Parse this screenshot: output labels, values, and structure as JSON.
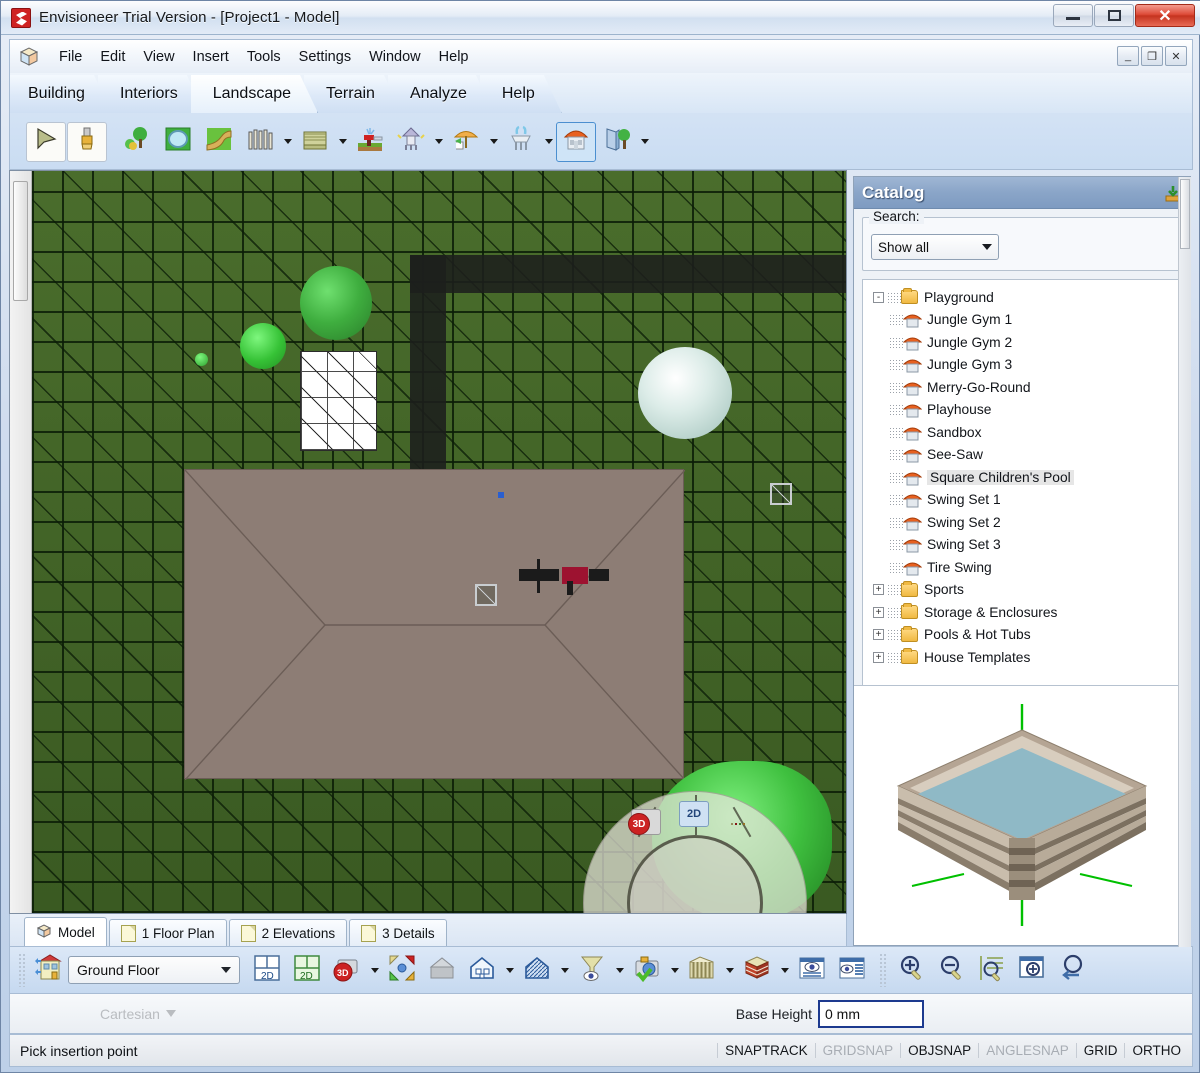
{
  "window": {
    "title": "Envisioneer Trial Version - [Project1 - Model]",
    "app_icon": "envisioneer-logo-icon",
    "minimize": "–",
    "maximize": "❐",
    "close": "✕"
  },
  "mdi_buttons": {
    "minimize": "_",
    "restore": "❐",
    "close": "✕"
  },
  "menu": {
    "items": [
      "File",
      "Edit",
      "View",
      "Insert",
      "Tools",
      "Settings",
      "Window",
      "Help"
    ]
  },
  "ribbon": {
    "tabs": [
      {
        "label": "Building",
        "active": false
      },
      {
        "label": "Interiors",
        "active": false
      },
      {
        "label": "Landscape",
        "active": true
      },
      {
        "label": "Terrain",
        "active": false
      },
      {
        "label": "Analyze",
        "active": false
      },
      {
        "label": "Help",
        "active": false
      }
    ],
    "tools": [
      {
        "name": "select-arrow-tool",
        "icon": "arrow-cursor-icon",
        "framed": true,
        "dropdown": false
      },
      {
        "name": "paintbrush-tool",
        "icon": "paintbrush-icon",
        "framed": true,
        "dropdown": false
      },
      {
        "name": "plants-tool",
        "icon": "tree-shrub-icon",
        "framed": false,
        "dropdown": false
      },
      {
        "name": "pond-tool",
        "icon": "pond-water-icon",
        "framed": false,
        "dropdown": false
      },
      {
        "name": "path-tool",
        "icon": "curved-path-icon",
        "framed": false,
        "dropdown": false
      },
      {
        "name": "fence-tool",
        "icon": "fence-icon",
        "framed": false,
        "dropdown": true
      },
      {
        "name": "deck-tool",
        "icon": "deck-bench-icon",
        "framed": false,
        "dropdown": true
      },
      {
        "name": "sprinkler-tool",
        "icon": "sprinkler-icon",
        "framed": false,
        "dropdown": false
      },
      {
        "name": "lamp-post-tool",
        "icon": "garden-lamp-icon",
        "framed": false,
        "dropdown": true
      },
      {
        "name": "umbrella-tool",
        "icon": "patio-umbrella-icon",
        "framed": false,
        "dropdown": true
      },
      {
        "name": "fountain-tool",
        "icon": "fountain-icon",
        "framed": false,
        "dropdown": true
      },
      {
        "name": "playground-tool",
        "icon": "gazebo-playhouse-icon",
        "framed": false,
        "dropdown": false,
        "selected": true
      },
      {
        "name": "catalog-browser-tool",
        "icon": "book-tree-icon",
        "framed": false,
        "dropdown": true
      }
    ]
  },
  "canvas": {
    "objects": [
      {
        "name": "house-roof-plan",
        "type": "roof"
      },
      {
        "name": "window-frame-object",
        "type": "window"
      },
      {
        "name": "tree-large",
        "type": "tree"
      },
      {
        "name": "tree-medium",
        "type": "tree"
      },
      {
        "name": "tree-small",
        "type": "tree"
      },
      {
        "name": "flowering-tree-white",
        "type": "tree"
      },
      {
        "name": "hedge-bush",
        "type": "hedge"
      },
      {
        "name": "signpost-object",
        "type": "signpost"
      }
    ],
    "radial_menu": {
      "items": [
        {
          "name": "view-3d-button",
          "label": "3D"
        },
        {
          "name": "view-2d-button",
          "label": "2D"
        },
        {
          "name": "move-handles-button",
          "label": ""
        },
        {
          "name": "rotate-button",
          "label": ""
        }
      ]
    },
    "cursor": "hand-cursor"
  },
  "doc_tabs": [
    {
      "label": "Model",
      "icon": "cube-icon",
      "active": true
    },
    {
      "label": "1 Floor Plan",
      "icon": "page-icon",
      "active": false
    },
    {
      "label": "2 Elevations",
      "icon": "page-icon",
      "active": false
    },
    {
      "label": "3 Details",
      "icon": "page-icon",
      "active": false
    }
  ],
  "bottom_toolbar": {
    "floor_selector": {
      "value": "Ground Floor",
      "icon": "building-levels-icon"
    },
    "buttons": [
      {
        "name": "view-2d-plan-button",
        "icon": "floorplan-2d-icon",
        "dropdown": false
      },
      {
        "name": "view-2d-color-button",
        "icon": "floorplan-2d-color-icon",
        "dropdown": false
      },
      {
        "name": "view-3d-camera-button",
        "icon": "camera-3d-icon",
        "dropdown": true
      },
      {
        "name": "move-rotate-button",
        "icon": "four-arrows-icon",
        "dropdown": false
      },
      {
        "name": "solid-model-button",
        "icon": "grey-house-icon",
        "dropdown": false
      },
      {
        "name": "wireframe-house-button",
        "icon": "outline-house-icon",
        "dropdown": true
      },
      {
        "name": "hatched-house-button",
        "icon": "hatched-house-icon",
        "dropdown": true
      },
      {
        "name": "view-filter-button",
        "icon": "funnel-eye-icon",
        "dropdown": true
      },
      {
        "name": "snapshot-button",
        "icon": "camera-check-icon",
        "dropdown": true
      },
      {
        "name": "section-cut-button",
        "icon": "wall-section-icon",
        "dropdown": true
      },
      {
        "name": "material-button",
        "icon": "brick-cube-icon",
        "dropdown": true
      },
      {
        "name": "display-options-button",
        "icon": "eye-list-icon",
        "dropdown": false
      },
      {
        "name": "display-layers-button",
        "icon": "eye-layers-icon",
        "dropdown": false
      },
      {
        "name": "zoom-in-button",
        "icon": "magnifier-plus-icon",
        "dropdown": false
      },
      {
        "name": "zoom-out-button",
        "icon": "magnifier-minus-icon",
        "dropdown": false
      },
      {
        "name": "zoom-extents-button",
        "icon": "magnifier-extents-icon",
        "dropdown": false
      },
      {
        "name": "zoom-window-button",
        "icon": "magnifier-window-icon",
        "dropdown": false
      },
      {
        "name": "zoom-previous-button",
        "icon": "magnifier-previous-icon",
        "dropdown": false
      }
    ]
  },
  "coord_row": {
    "cartesian_label": "Cartesian",
    "base_height_label": "Base Height",
    "base_height_value": "0 mm"
  },
  "status": {
    "message": "Pick insertion point",
    "flags": [
      {
        "label": "SNAPTRACK",
        "on": true
      },
      {
        "label": "GRIDSNAP",
        "on": false
      },
      {
        "label": "OBJSNAP",
        "on": true
      },
      {
        "label": "ANGLESNAP",
        "on": false
      },
      {
        "label": "GRID",
        "on": true
      },
      {
        "label": "ORTHO",
        "on": true
      }
    ]
  },
  "catalog": {
    "title": "Catalog",
    "pin_icon": "download-catalog-icon",
    "search_label": "Search:",
    "filter_value": "Show all",
    "tree": [
      {
        "label": "Playground",
        "type": "folder",
        "expanded": true,
        "level": 0,
        "toggle": "-"
      },
      {
        "label": "Jungle Gym 1",
        "type": "item",
        "level": 1,
        "selected": false
      },
      {
        "label": "Jungle Gym 2",
        "type": "item",
        "level": 1,
        "selected": false
      },
      {
        "label": "Jungle Gym 3",
        "type": "item",
        "level": 1,
        "selected": false
      },
      {
        "label": "Merry-Go-Round",
        "type": "item",
        "level": 1,
        "selected": false
      },
      {
        "label": "Playhouse",
        "type": "item",
        "level": 1,
        "selected": false
      },
      {
        "label": "Sandbox",
        "type": "item",
        "level": 1,
        "selected": false
      },
      {
        "label": "See-Saw",
        "type": "item",
        "level": 1,
        "selected": false
      },
      {
        "label": "Square Children's Pool",
        "type": "item",
        "level": 1,
        "selected": true
      },
      {
        "label": "Swing Set 1",
        "type": "item",
        "level": 1,
        "selected": false
      },
      {
        "label": "Swing Set 2",
        "type": "item",
        "level": 1,
        "selected": false
      },
      {
        "label": "Swing Set 3",
        "type": "item",
        "level": 1,
        "selected": false
      },
      {
        "label": "Tire Swing",
        "type": "item",
        "level": 1,
        "selected": false
      },
      {
        "label": "Sports",
        "type": "folder",
        "expanded": false,
        "level": 0,
        "toggle": "+"
      },
      {
        "label": "Storage & Enclosures",
        "type": "folder",
        "expanded": false,
        "level": 0,
        "toggle": "+"
      },
      {
        "label": "Pools & Hot Tubs",
        "type": "folder",
        "expanded": false,
        "level": 0,
        "toggle": "+"
      },
      {
        "label": "House Templates",
        "type": "folder",
        "expanded": false,
        "level": 0,
        "toggle": "+"
      }
    ],
    "preview": {
      "name": "square-childrens-pool-preview"
    }
  },
  "colors": {
    "accent": "#8aa5c8",
    "titlebar_close": "#dd4b38",
    "terrain_green": "#3f6127",
    "roof_brown": "#8d7d75",
    "selection_blue": "#4b8fd0",
    "field_border": "#1d3a8f"
  }
}
